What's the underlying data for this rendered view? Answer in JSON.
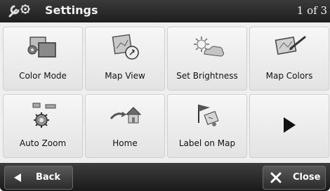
{
  "header": {
    "title": "Settings",
    "page_indicator": "1 of 3"
  },
  "tiles": [
    {
      "label": "Color Mode",
      "icon": "color-mode-icon"
    },
    {
      "label": "Map View",
      "icon": "map-view-icon"
    },
    {
      "label": "Set Brightness",
      "icon": "brightness-icon"
    },
    {
      "label": "Map Colors",
      "icon": "map-colors-icon"
    },
    {
      "label": "Auto Zoom",
      "icon": "auto-zoom-icon"
    },
    {
      "label": "Home",
      "icon": "home-icon"
    },
    {
      "label": "Label on Map",
      "icon": "label-on-map-icon"
    },
    {
      "label": "",
      "icon": "next-page-arrow-icon"
    }
  ],
  "footer": {
    "back_label": "Back",
    "close_label": "Close"
  }
}
